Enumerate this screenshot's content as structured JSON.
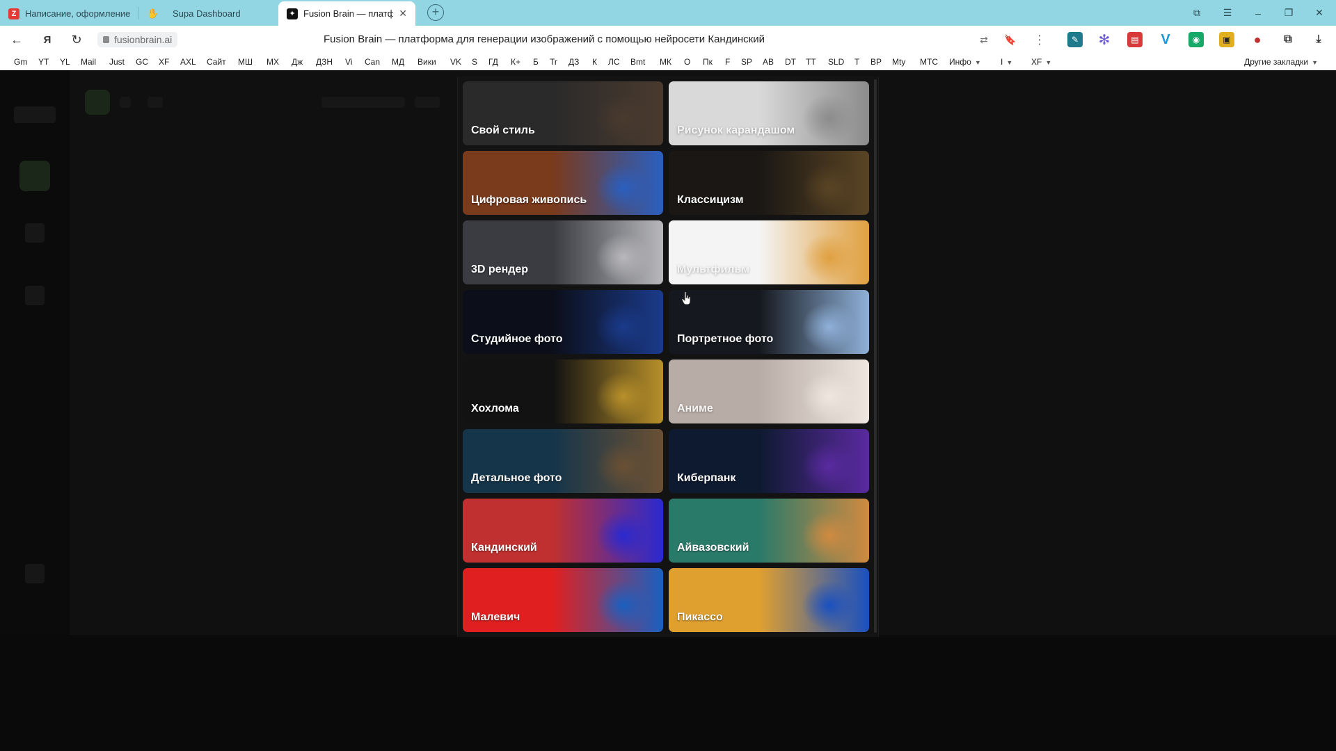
{
  "tabs": [
    {
      "label": "Написание, оформление",
      "favicon": "red-square-icon",
      "active": false
    },
    {
      "label": "Supa Dashboard",
      "favicon": "hand-icon",
      "active": false
    },
    {
      "label": "Fusion Brain — платфор",
      "favicon": "fusion-brain-icon",
      "active": true
    }
  ],
  "address": {
    "url": "fusionbrain.ai",
    "title": "Fusion Brain — платформа для генерации изображений с помощью нейросети Кандинский"
  },
  "bookmarks": [
    "Gm",
    "YT",
    "YL",
    "Mail",
    "Just",
    "GC",
    "XF",
    "AXL",
    "Сайт",
    "МШ",
    "МХ",
    "Дж",
    "ДЗН",
    "Vi",
    "Can",
    "МД",
    "Вики",
    "VK",
    "S",
    "ГД",
    "К+",
    "Б",
    "Tr",
    "ДЗ",
    "К",
    "ЛС",
    "Bmt",
    "МК",
    "О",
    "Пк",
    "F",
    "SP",
    "АВ",
    "DT",
    "ТТ",
    "SLD",
    "Т",
    "ВР",
    "Mty",
    "МТС",
    "Инфо",
    "I",
    "XF"
  ],
  "bookmarks_other": "Другие закладки",
  "styles": [
    {
      "label": "Свой стиль",
      "bg": "#2a2a2a",
      "art": "#4a3a2e"
    },
    {
      "label": "Рисунок карандашом",
      "bg": "#d9d9d9",
      "art": "#8c8c8c",
      "light": true
    },
    {
      "label": "Цифровая живопись",
      "bg": "#7a3a1c",
      "art": "#2a5fc0"
    },
    {
      "label": "Классицизм",
      "bg": "#1a1714",
      "art": "#5a4424"
    },
    {
      "label": "3D рендер",
      "bg": "#3a3c42",
      "art": "#b8b8bc"
    },
    {
      "label": "Мультфильм",
      "bg": "#f4f4f4",
      "art": "#e0a040",
      "light": true
    },
    {
      "label": "Студийное фото",
      "bg": "#0c0f1a",
      "art": "#1a3a8a"
    },
    {
      "label": "Портретное фото",
      "bg": "#15181e",
      "art": "#8fb0d8"
    },
    {
      "label": "Хохлома",
      "bg": "#121212",
      "art": "#b8902a"
    },
    {
      "label": "Аниме",
      "bg": "#b8aca6",
      "art": "#efe6e0",
      "light": true
    },
    {
      "label": "Детальное фото",
      "bg": "#15354a",
      "art": "#6a5034"
    },
    {
      "label": "Киберпанк",
      "bg": "#0e1a30",
      "art": "#5a2aa0"
    },
    {
      "label": "Кандинский",
      "bg": "#c03030",
      "art": "#2a2ad0"
    },
    {
      "label": "Айвазовский",
      "bg": "#2a7a6a",
      "art": "#d08a40"
    },
    {
      "label": "Малевич",
      "bg": "#e02020",
      "art": "#1a60c0"
    },
    {
      "label": "Пикассо",
      "bg": "#e0a030",
      "art": "#1a50c0"
    }
  ]
}
